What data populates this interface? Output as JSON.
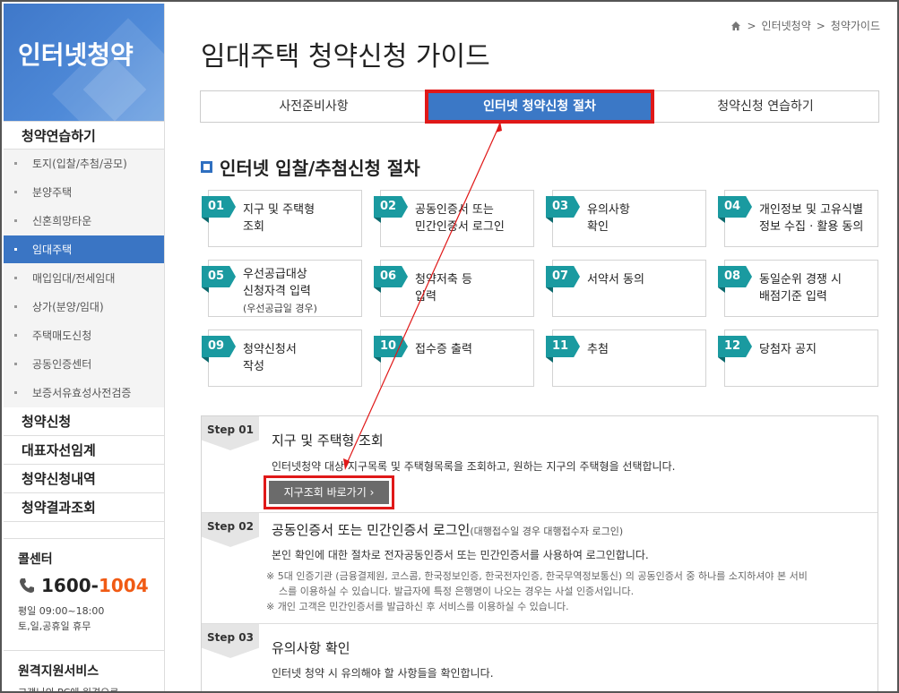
{
  "sidebar": {
    "title": "인터넷청약",
    "section1": "청약연습하기",
    "sub_items": [
      "토지(입찰/추첨/공모)",
      "분양주택",
      "신혼희망타운",
      "임대주택",
      "매입임대/전세임대",
      "상가(분양/임대)",
      "주택매도신청",
      "공동인증센터",
      "보증서유효성사전검증"
    ],
    "active_index": 3,
    "majors": [
      "청약신청",
      "대표자선임계",
      "청약신청내역",
      "청약결과조회"
    ],
    "call_label": "콜센터",
    "call_number_a": "1600-",
    "call_number_b": "1004",
    "hours_1": "평일 09:00~18:00",
    "hours_2": "토,일,공휴일 휴무",
    "remote_title": "원격지원서비스",
    "remote_desc": "고객님의 PC에 원격으로"
  },
  "breadcrumb": {
    "item1": "인터넷청약",
    "sep": ">",
    "item2": "청약가이드"
  },
  "page_title": "임대주택 청약신청 가이드",
  "tabs": [
    "사전준비사항",
    "인터넷 청약신청 절차",
    "청약신청 연습하기"
  ],
  "section_title": "인터넷 입찰/추첨신청 절차",
  "cards": [
    {
      "num": "01",
      "l1": "지구 및 주택형",
      "l2": "조회",
      "l3": ""
    },
    {
      "num": "02",
      "l1": "공동인증서 또는",
      "l2": "민간인증서 로그인",
      "l3": ""
    },
    {
      "num": "03",
      "l1": "유의사항",
      "l2": "확인",
      "l3": ""
    },
    {
      "num": "04",
      "l1": "개인정보 및 고유식별",
      "l2": "정보 수집 · 활용 동의",
      "l3": ""
    },
    {
      "num": "05",
      "l1": "우선공급대상",
      "l2": "신청자격 입력",
      "l3": "(우선공급일 경우)"
    },
    {
      "num": "06",
      "l1": "청약저축 등",
      "l2": "입력",
      "l3": ""
    },
    {
      "num": "07",
      "l1": "서약서 동의",
      "l2": "",
      "l3": ""
    },
    {
      "num": "08",
      "l1": "동일순위 경쟁 시",
      "l2": "배점기준 입력",
      "l3": ""
    },
    {
      "num": "09",
      "l1": "청약신청서",
      "l2": "작성",
      "l3": ""
    },
    {
      "num": "10",
      "l1": "접수증 출력",
      "l2": "",
      "l3": ""
    },
    {
      "num": "11",
      "l1": "추첨",
      "l2": "",
      "l3": ""
    },
    {
      "num": "12",
      "l1": "당첨자 공지",
      "l2": "",
      "l3": ""
    }
  ],
  "steps": {
    "s1": {
      "badge": "Step 01",
      "title": "지구 및 주택형 조회",
      "desc": "인터넷청약 대상 지구목록 및 주택형목록을 조회하고, 원하는 지구의 주택형을 선택합니다.",
      "button": "지구조회 바로가기  ›"
    },
    "s2": {
      "badge": "Step 02",
      "title": "공동인증서 또는 민간인증서 로그인",
      "title_small": "(대행접수일 경우 대행접수자 로그인)",
      "desc": "본인 확인에 대한 절차로 전자공동인증서 또는 민간인증서를 사용하여 로그인합니다.",
      "note1": "※ 5대 인증기관 (금융결제원, 코스콤, 한국정보인증, 한국전자인증, 한국무역정보통신) 의 공동인증서 중 하나를 소지하셔야 본 서비",
      "note2": "스를 이용하실 수 있습니다. 발급자에 특정 은행명이 나오는 경우는 사설 인증서입니다.",
      "note3": "※ 개인 고객은 민간인증서를 발급하신 후 서비스를 이용하실 수 있습니다."
    },
    "s3": {
      "badge": "Step 03",
      "title": "유의사항 확인",
      "desc": "인터넷 청약 시 유의해야 할 사항들을 확인합니다."
    }
  },
  "colors": {
    "accent_blue": "#3b78c6",
    "teal": "#1a9aa0",
    "highlight_red": "#e01818",
    "phone_orange": "#f05a14"
  }
}
